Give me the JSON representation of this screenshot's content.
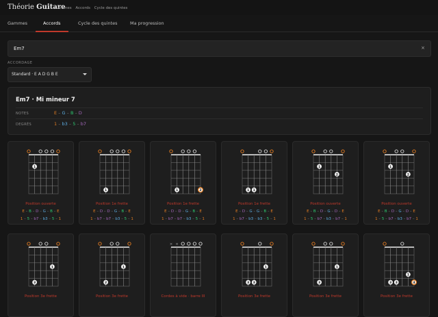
{
  "brand": {
    "part1": "Théorie ",
    "part2": "Guitare"
  },
  "breadcrumbs": [
    "Gammes",
    "Accords",
    "Cycle des quintes"
  ],
  "tabs": [
    "Gammes",
    "Accords",
    "Cycle des quintes",
    "Ma progression"
  ],
  "active_tab": 1,
  "search": {
    "value": "Em7",
    "clear_label": "×"
  },
  "tuning": {
    "label": "ACCORDAGE",
    "value": "Standard · E A D G B E"
  },
  "chord": {
    "title": "Em7 · Mi mineur 7",
    "notes_label": "NOTES",
    "degrees_label": "DEGRÉS",
    "notes": [
      {
        "text": "E",
        "color": "#e67e22"
      },
      {
        "text": "G",
        "color": "#5dade2"
      },
      {
        "text": "B",
        "color": "#2ecc71"
      },
      {
        "text": "D",
        "color": "#a569bd"
      }
    ],
    "degrees": [
      {
        "text": "1",
        "color": "#e67e22"
      },
      {
        "text": "b3",
        "color": "#5dade2"
      },
      {
        "text": "5",
        "color": "#2ecc71"
      },
      {
        "text": "b7",
        "color": "#a569bd"
      }
    ]
  },
  "colors": {
    "accent": "#c0392b",
    "root": "#e67e22",
    "third": "#5dade2",
    "fifth": "#2ecc71",
    "seventh": "#a569bd"
  },
  "voicings": [
    {
      "label": "Position ouverte",
      "strings": [
        {
          "s": "o",
          "c": "root"
        },
        {
          "s": "f",
          "fret": 2,
          "finger": "1"
        },
        {
          "s": "o"
        },
        {
          "s": "o"
        },
        {
          "s": "o"
        },
        {
          "s": "o",
          "c": "root"
        }
      ],
      "notes": [
        {
          "t": "E",
          "c": "root"
        },
        {
          "t": "B",
          "c": "fifth"
        },
        {
          "t": "D",
          "c": "seventh"
        },
        {
          "t": "G",
          "c": "third"
        },
        {
          "t": "B",
          "c": "fifth"
        },
        {
          "t": "E",
          "c": "root"
        }
      ],
      "degrees": [
        {
          "t": "1",
          "c": "root"
        },
        {
          "t": "5",
          "c": "fifth"
        },
        {
          "t": "b7",
          "c": "seventh"
        },
        {
          "t": "b3",
          "c": "third"
        },
        {
          "t": "5",
          "c": "fifth"
        },
        {
          "t": "1",
          "c": "root"
        }
      ]
    },
    {
      "label": "Position 1e frette",
      "strings": [
        {
          "s": "o",
          "c": "root"
        },
        {
          "s": "f",
          "fret": 5,
          "finger": "1"
        },
        {
          "s": "o"
        },
        {
          "s": "o"
        },
        {
          "s": "o"
        },
        {
          "s": "o",
          "c": "root"
        }
      ],
      "notes": [
        {
          "t": "E",
          "c": "root"
        },
        {
          "t": "D",
          "c": "seventh"
        },
        {
          "t": "D",
          "c": "seventh"
        },
        {
          "t": "G",
          "c": "third"
        },
        {
          "t": "B",
          "c": "fifth"
        },
        {
          "t": "E",
          "c": "root"
        }
      ],
      "degrees": [
        {
          "t": "1",
          "c": "root"
        },
        {
          "t": "b7",
          "c": "seventh"
        },
        {
          "t": "b7",
          "c": "seventh"
        },
        {
          "t": "b3",
          "c": "third"
        },
        {
          "t": "5",
          "c": "fifth"
        },
        {
          "t": "1",
          "c": "root"
        }
      ]
    },
    {
      "label": "Position 1e frette",
      "strings": [
        {
          "s": "o",
          "c": "root"
        },
        {
          "s": "f",
          "fret": 5,
          "finger": "1"
        },
        {
          "s": "o"
        },
        {
          "s": "o"
        },
        {
          "s": "o"
        },
        {
          "s": "f",
          "fret": 5,
          "finger": "2",
          "root": true
        }
      ],
      "notes": [
        {
          "t": "E",
          "c": "root"
        },
        {
          "t": "D",
          "c": "seventh"
        },
        {
          "t": "D",
          "c": "seventh"
        },
        {
          "t": "G",
          "c": "third"
        },
        {
          "t": "B",
          "c": "fifth"
        },
        {
          "t": "E",
          "c": "root"
        }
      ],
      "degrees": [
        {
          "t": "1",
          "c": "root"
        },
        {
          "t": "b7",
          "c": "seventh"
        },
        {
          "t": "b7",
          "c": "seventh"
        },
        {
          "t": "b3",
          "c": "third"
        },
        {
          "t": "5",
          "c": "fifth"
        },
        {
          "t": "1",
          "c": "root"
        }
      ]
    },
    {
      "label": "Position 1e frette",
      "strings": [
        {
          "s": "o",
          "c": "root"
        },
        {
          "s": "f",
          "fret": 5,
          "finger": "1"
        },
        {
          "s": "f",
          "fret": 5,
          "finger": "1"
        },
        {
          "s": "o"
        },
        {
          "s": "o"
        },
        {
          "s": "o",
          "c": "root"
        }
      ],
      "notes": [
        {
          "t": "E",
          "c": "root"
        },
        {
          "t": "D",
          "c": "seventh"
        },
        {
          "t": "G",
          "c": "third"
        },
        {
          "t": "G",
          "c": "third"
        },
        {
          "t": "B",
          "c": "fifth"
        },
        {
          "t": "E",
          "c": "root"
        }
      ],
      "degrees": [
        {
          "t": "1",
          "c": "root"
        },
        {
          "t": "b7",
          "c": "seventh"
        },
        {
          "t": "b3",
          "c": "third"
        },
        {
          "t": "b3",
          "c": "third"
        },
        {
          "t": "5",
          "c": "fifth"
        },
        {
          "t": "1",
          "c": "root"
        }
      ]
    },
    {
      "label": "Position ouverte",
      "strings": [
        {
          "s": "o",
          "c": "root"
        },
        {
          "s": "f",
          "fret": 2,
          "finger": "1"
        },
        {
          "s": "o"
        },
        {
          "s": "o"
        },
        {
          "s": "f",
          "fret": 3,
          "finger": "2"
        },
        {
          "s": "o",
          "c": "root"
        }
      ],
      "notes": [
        {
          "t": "E",
          "c": "root"
        },
        {
          "t": "B",
          "c": "fifth"
        },
        {
          "t": "D",
          "c": "seventh"
        },
        {
          "t": "G",
          "c": "third"
        },
        {
          "t": "D",
          "c": "seventh"
        },
        {
          "t": "E",
          "c": "root"
        }
      ],
      "degrees": [
        {
          "t": "1",
          "c": "root"
        },
        {
          "t": "5",
          "c": "fifth"
        },
        {
          "t": "b7",
          "c": "seventh"
        },
        {
          "t": "b3",
          "c": "third"
        },
        {
          "t": "b7",
          "c": "seventh"
        },
        {
          "t": "1",
          "c": "root"
        }
      ]
    },
    {
      "label": "Position ouverte",
      "strings": [
        {
          "s": "o",
          "c": "root"
        },
        {
          "s": "f",
          "fret": 2,
          "finger": "1"
        },
        {
          "s": "o"
        },
        {
          "s": "o"
        },
        {
          "s": "f",
          "fret": 3,
          "finger": "2"
        },
        {
          "s": "o",
          "c": "root"
        }
      ],
      "notes": [
        {
          "t": "E",
          "c": "root"
        },
        {
          "t": "B",
          "c": "fifth"
        },
        {
          "t": "D",
          "c": "seventh"
        },
        {
          "t": "G",
          "c": "third"
        },
        {
          "t": "D",
          "c": "seventh"
        },
        {
          "t": "E",
          "c": "root"
        }
      ],
      "degrees": [
        {
          "t": "1",
          "c": "root"
        },
        {
          "t": "5",
          "c": "fifth"
        },
        {
          "t": "b7",
          "c": "seventh"
        },
        {
          "t": "b3",
          "c": "third"
        },
        {
          "t": "b7",
          "c": "seventh"
        },
        {
          "t": "1",
          "c": "root"
        }
      ]
    },
    {
      "label": "Position 3e frette",
      "strings": [
        {
          "s": "o",
          "c": "root"
        },
        {
          "s": "f",
          "fret": 5,
          "finger": "3"
        },
        {
          "s": "o"
        },
        {
          "s": "o"
        },
        {
          "s": "f",
          "fret": 3,
          "finger": "1"
        },
        {
          "s": "o",
          "c": "root"
        }
      ],
      "notes": [],
      "degrees": []
    },
    {
      "label": "Position 3e frette",
      "strings": [
        {
          "s": "o",
          "c": "root"
        },
        {
          "s": "f",
          "fret": 5,
          "finger": "2"
        },
        {
          "s": "o"
        },
        {
          "s": "o"
        },
        {
          "s": "f",
          "fret": 3,
          "finger": "1"
        },
        {
          "s": "o",
          "c": "root"
        }
      ],
      "notes": [],
      "degrees": []
    },
    {
      "label": "Cordes à vide · barre III",
      "strings": [
        {
          "s": "x"
        },
        {
          "s": "x"
        },
        {
          "s": "o"
        },
        {
          "s": "o"
        },
        {
          "s": "o"
        },
        {
          "s": "o"
        }
      ],
      "notes": [],
      "degrees": []
    },
    {
      "label": "Position 3e frette",
      "strings": [
        {
          "s": "o",
          "c": "root"
        },
        {
          "s": "f",
          "fret": 5,
          "finger": "3"
        },
        {
          "s": "f",
          "fret": 5,
          "finger": "3"
        },
        {
          "s": "o"
        },
        {
          "s": "f",
          "fret": 3,
          "finger": "1"
        },
        {
          "s": "o",
          "c": "root"
        }
      ],
      "notes": [],
      "degrees": []
    },
    {
      "label": "Position 3e frette",
      "strings": [
        {
          "s": "o",
          "c": "root"
        },
        {
          "s": "f",
          "fret": 5,
          "finger": "3"
        },
        {
          "s": "o"
        },
        {
          "s": "o"
        },
        {
          "s": "f",
          "fret": 3,
          "finger": "1"
        },
        {
          "s": "o",
          "c": "root"
        }
      ],
      "notes": [],
      "degrees": []
    },
    {
      "label": "Position 3e frette",
      "strings": [
        {
          "s": "o",
          "c": "root"
        },
        {
          "s": "f",
          "fret": 5,
          "finger": "3"
        },
        {
          "s": "f",
          "fret": 5,
          "finger": "3"
        },
        {
          "s": "o"
        },
        {
          "s": "f",
          "fret": 4,
          "finger": "1"
        },
        {
          "s": "f",
          "fret": 5,
          "finger": "4",
          "root": true
        }
      ],
      "notes": [],
      "degrees": []
    }
  ]
}
